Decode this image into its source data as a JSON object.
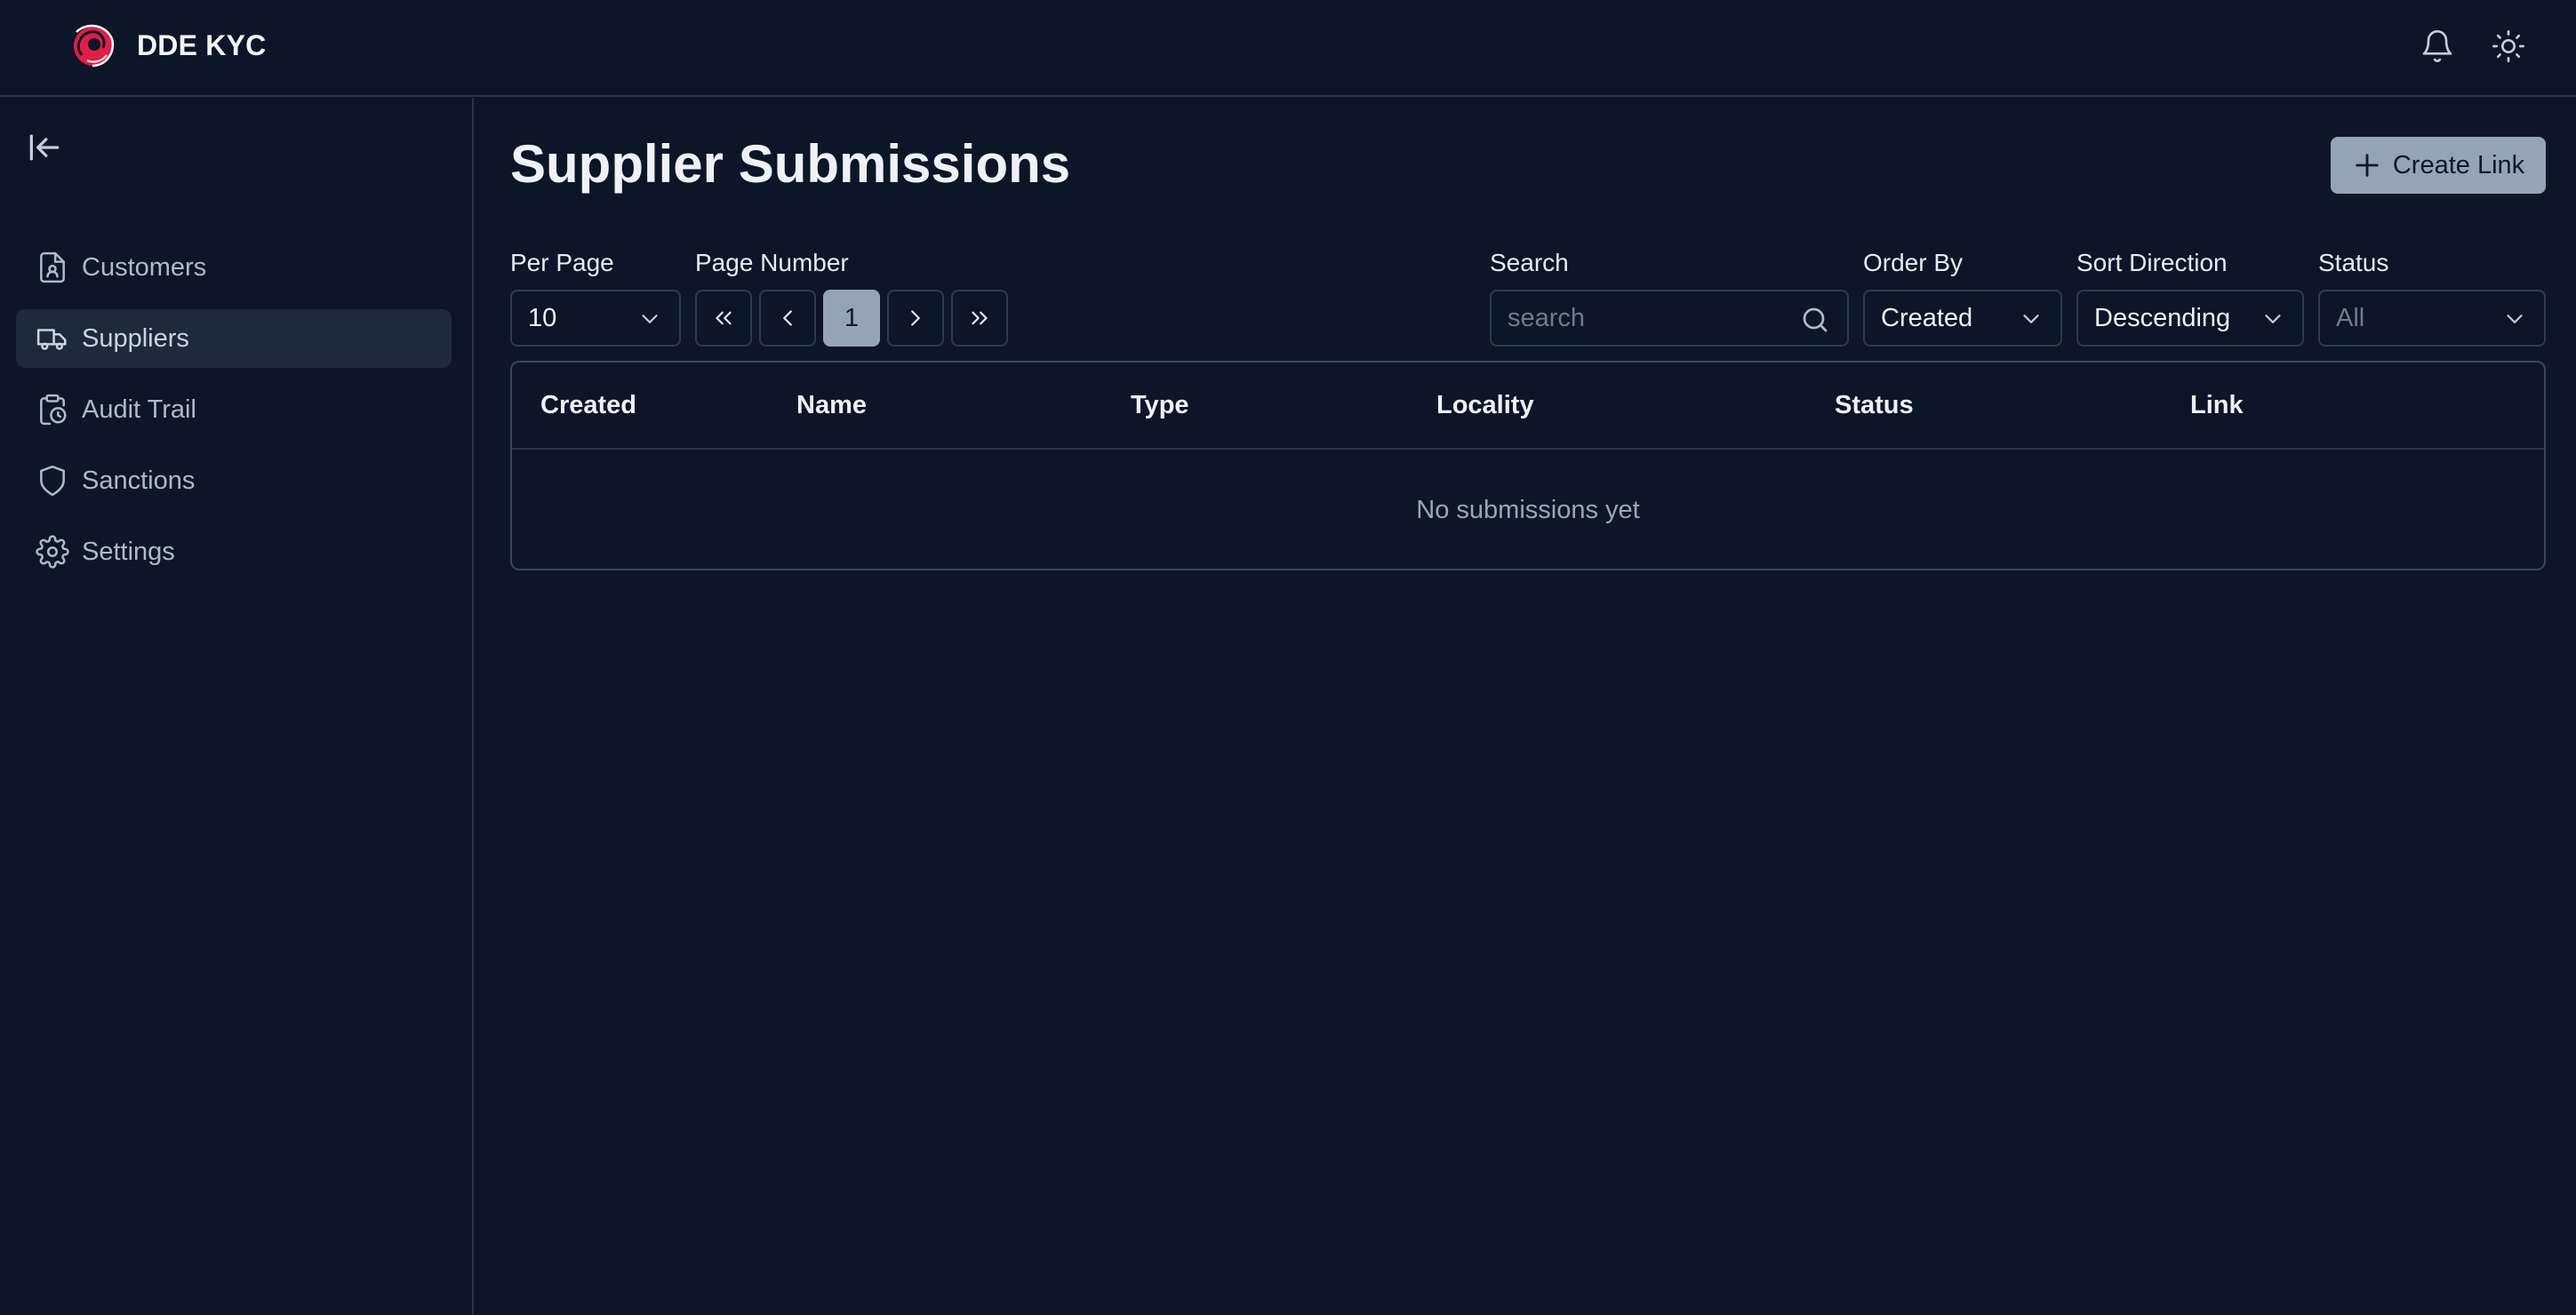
{
  "app": {
    "title": "DDE KYC"
  },
  "header": {
    "notifications_icon": "bell-icon",
    "theme_icon": "sun-icon"
  },
  "sidebar": {
    "collapse_icon": "collapse-left-icon",
    "items": [
      {
        "label": "Customers",
        "icon": "customer-file-icon",
        "active": false
      },
      {
        "label": "Suppliers",
        "icon": "truck-icon",
        "active": true
      },
      {
        "label": "Audit Trail",
        "icon": "clipboard-clock-icon",
        "active": false
      },
      {
        "label": "Sanctions",
        "icon": "shield-icon",
        "active": false
      },
      {
        "label": "Settings",
        "icon": "gear-icon",
        "active": false
      }
    ]
  },
  "main": {
    "title": "Supplier Submissions",
    "create_button": "Create Link",
    "filters": {
      "per_page": {
        "label": "Per Page",
        "value": "10"
      },
      "page_number": {
        "label": "Page Number",
        "current": "1"
      },
      "search": {
        "label": "Search",
        "placeholder": "search"
      },
      "order_by": {
        "label": "Order By",
        "value": "Created"
      },
      "sort_direction": {
        "label": "Sort Direction",
        "value": "Descending"
      },
      "status": {
        "label": "Status",
        "value": "All"
      }
    },
    "table": {
      "columns": [
        "Created",
        "Name",
        "Type",
        "Locality",
        "Status",
        "Link"
      ],
      "empty_message": "No submissions yet"
    }
  },
  "colors": {
    "background": "#0d1628",
    "accent": "#94a3b8",
    "active_nav": "#1e293b",
    "logo": "#e11d48"
  }
}
